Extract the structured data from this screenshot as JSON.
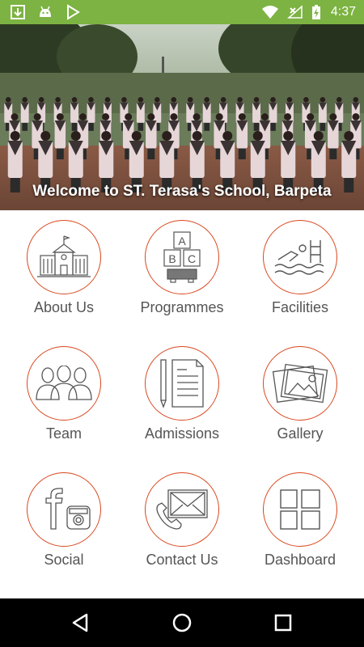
{
  "status_bar": {
    "time": "4:37",
    "left_icons": [
      "download-icon",
      "android-icon",
      "play-store-icon"
    ],
    "right_icons": [
      "wifi-icon",
      "no-signal-icon",
      "battery-charging-icon"
    ],
    "background": "#7cb342"
  },
  "hero": {
    "caption": "Welcome to ST. Terasa's School, Barpeta"
  },
  "menu": {
    "accent_color": "#d9461c",
    "items": [
      {
        "label": "About Us",
        "icon": "school-building-icon"
      },
      {
        "label": "Programmes",
        "icon": "abc-blocks-icon"
      },
      {
        "label": "Facilities",
        "icon": "swimming-pool-icon"
      },
      {
        "label": "Team",
        "icon": "people-group-icon"
      },
      {
        "label": "Admissions",
        "icon": "document-pencil-icon"
      },
      {
        "label": "Gallery",
        "icon": "photo-gallery-icon"
      },
      {
        "label": "Social",
        "icon": "facebook-instagram-icon"
      },
      {
        "label": "Contact Us",
        "icon": "phone-mail-icon"
      },
      {
        "label": "Dashboard",
        "icon": "dashboard-grid-icon"
      }
    ]
  },
  "nav_bar": {
    "buttons": [
      "back-icon",
      "home-icon",
      "recents-icon"
    ]
  }
}
